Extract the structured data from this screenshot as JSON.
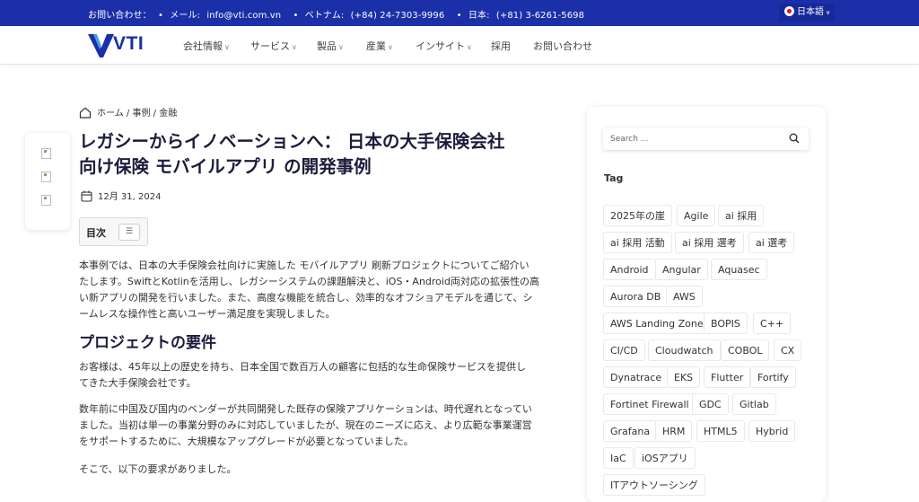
{
  "topbar": {
    "contact_label": "お問い合わせ：",
    "email_label": "メール: ",
    "email": "info@vti.com.vn",
    "vn_label": "ベトナム: ",
    "vn_phone": "(+84) 24-7303-9996",
    "jp_label": "日本: ",
    "jp_phone": "(+81) 3-6261-5698",
    "language": "日本語"
  },
  "header": {
    "logo_text": "VTI",
    "nav": [
      {
        "label": "会社情報",
        "has_dropdown": true
      },
      {
        "label": "サービス",
        "has_dropdown": true
      },
      {
        "label": "製品",
        "has_dropdown": true
      },
      {
        "label": "産業",
        "has_dropdown": true
      },
      {
        "label": "インサイト",
        "has_dropdown": true
      },
      {
        "label": "採用",
        "has_dropdown": false
      },
      {
        "label": "お問い合わせ",
        "has_dropdown": false
      }
    ]
  },
  "breadcrumb": {
    "home": "ホーム",
    "sep": "/",
    "cat": "事例",
    "sub": "金融"
  },
  "article": {
    "title_line1": "レガシーからイノベーションへ： 日本の大手保険会社",
    "title_line2": "向け保険 モバイルアプリ の開発事例",
    "date": "12月 31, 2024",
    "toc_label": "目次",
    "intro": [
      "本事例では、日本の大手保険会社向けに実施した モバイルアプリ 刷新プロジェクトについてご紹介い",
      "たします。SwiftとKotlinを活用し、レガシーシステムの課題解決と、iOS・Android両対応の拡張性の高",
      "い新アプリの開発を行いました。また、高度な機能を統合し、効率的なオフショアモデルを通じて、シ",
      "ームレスな操作性と高いユーザー満足度を実現しました。"
    ],
    "h2": "プロジェクトの要件",
    "p1": [
      "お客様は、45年以上の歴史を持ち、日本全国で数百万人の顧客に包括的な生命保険サービスを提供し",
      "てきた大手保険会社です。"
    ],
    "p2": [
      "数年前に中国及び国内のベンダーが共同開発した既存の保険アプリケーションは、時代遅れとなってい",
      "ました。当初は単一の事業分野のみに対応していましたが、現在のニーズに応え、より広範な事業運営",
      "をサポートするために、大規模なアップグレードが必要となっていました。"
    ],
    "p3": "そこで、以下の要求がありました。"
  },
  "sidebar": {
    "search_placeholder": "Search ...",
    "tag_title": "Tag",
    "tags": [
      [
        "2025年の崖",
        "Agile",
        "ai 採用"
      ],
      [
        "ai 採用 活動",
        "ai 採用 選考",
        "ai 選考"
      ],
      [
        "Android",
        "Angular",
        "Aquasec"
      ],
      [
        "Aurora DB",
        "AWS"
      ],
      [
        "AWS Landing Zone",
        "BOPIS",
        "C++"
      ],
      [
        "CI/CD",
        "Cloudwatch",
        "COBOL",
        "CX"
      ],
      [
        "Dynatrace",
        "EKS",
        "Flutter",
        "Fortify"
      ],
      [
        "Fortinet Firewall",
        "GDC",
        "Gitlab"
      ],
      [
        "Grafana",
        "HRM",
        "HTML5",
        "Hybrid"
      ],
      [
        "IaC",
        "iOSアプリ"
      ],
      [
        "ITアウトソーシング"
      ]
    ]
  },
  "colors": {
    "brand_blue": "#1a2fa8",
    "title_navy": "#1a1d3a"
  }
}
